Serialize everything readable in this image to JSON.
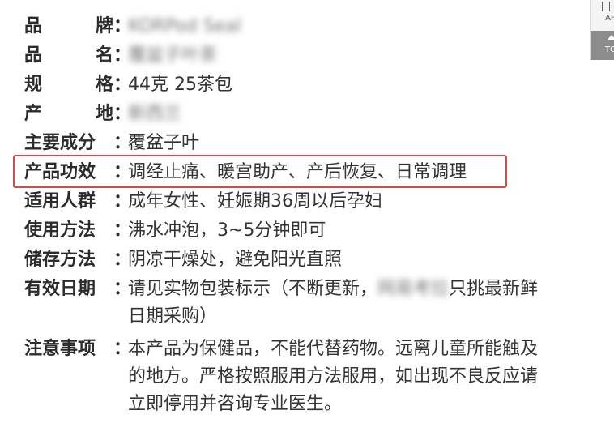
{
  "rows": [
    {
      "label": "品牌",
      "colon": "：",
      "value": "KORPod Seal"
    },
    {
      "label": "品名",
      "colon": "：",
      "value": "覆盆子叶茶"
    },
    {
      "label": "规格",
      "colon": "：",
      "value": "44克 25茶包"
    },
    {
      "label": "产地",
      "colon": "：",
      "value": "新西兰"
    },
    {
      "label": "主要成分",
      "colon": "：",
      "value": "覆盆子叶"
    },
    {
      "label": "产品功效",
      "colon": "：",
      "value": "调经止痛、暖宫助产、产后恢复、日常调理"
    },
    {
      "label": "适用人群",
      "colon": "：",
      "value": "成年女性、妊娠期36周以后孕妇"
    },
    {
      "label": "使用方法",
      "colon": "：",
      "value": "沸水冲泡，3~5分钟即可"
    },
    {
      "label": "储存方法",
      "colon": "：",
      "value": "阴凉干燥处，避免阳光直照"
    },
    {
      "label": "有效日期",
      "colon": "：",
      "value_part1": "请见实物包装标示（不断更新，",
      "value_redacted": "网易考拉",
      "value_part2": "只挑最新鲜",
      "value_line2": "日期采购）"
    },
    {
      "label": "注意事项",
      "colon": "：",
      "value_line1": "本产品为保健品，不能代替药物。远离儿童所能触及",
      "value_line2": "的地方。严格按照服用方法服用，如出现不良反应请",
      "value_line3": "立即停用并咨询专业医生。"
    }
  ],
  "side": {
    "top_label": "AF",
    "bottom_label": "TO"
  },
  "colors": {
    "highlight_border": "#d24b4b",
    "text": "#333333"
  }
}
